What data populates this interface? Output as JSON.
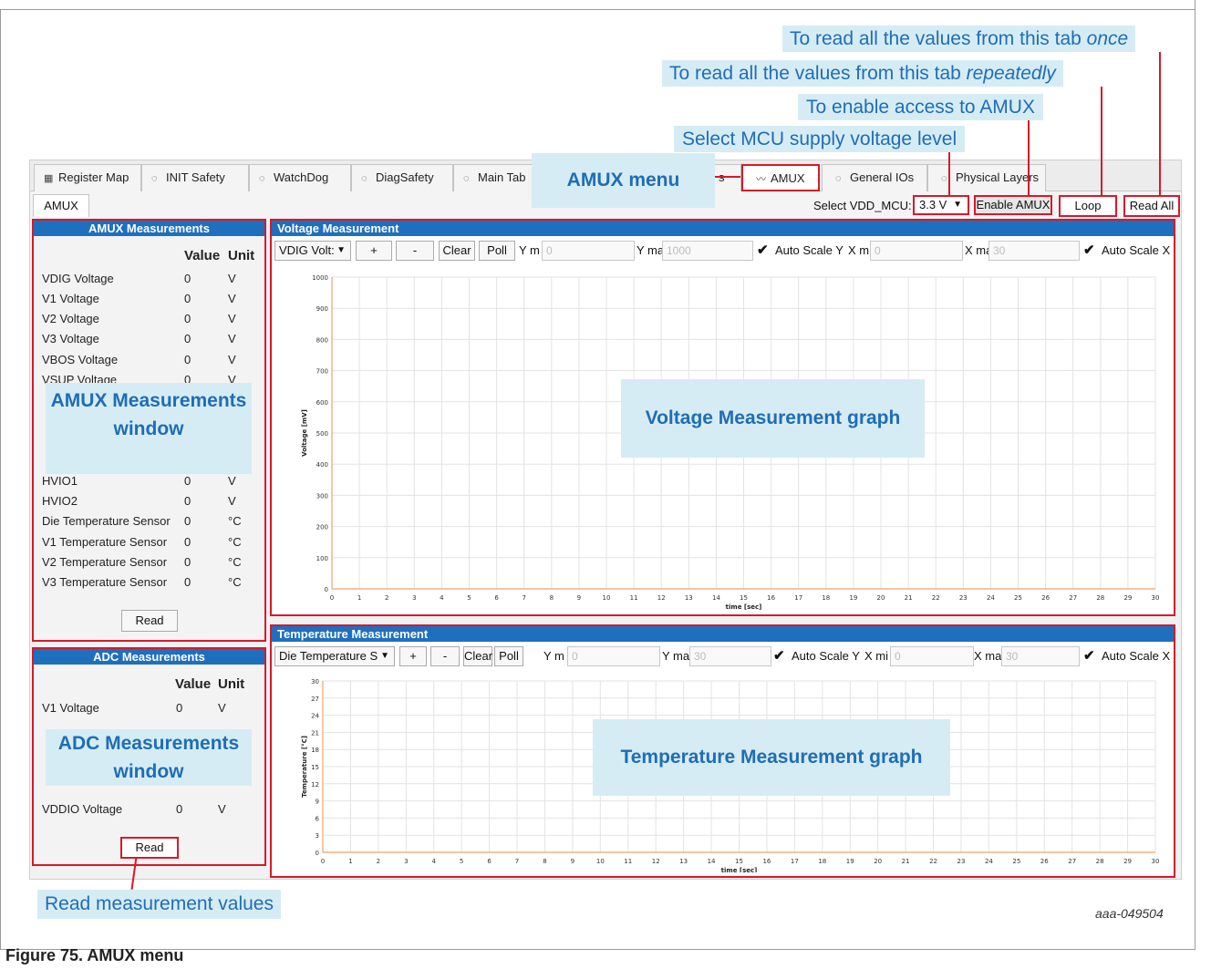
{
  "figure": {
    "caption": "Figure 75.  AMUX menu",
    "code": "aaa-049504"
  },
  "tabs": [
    {
      "label": "Register Map",
      "icon": "grid-icon"
    },
    {
      "label": "INIT Safety",
      "icon": "shield-icon"
    },
    {
      "label": "WatchDog",
      "icon": "shield-icon"
    },
    {
      "label": "DiagSafety",
      "icon": "shield-icon"
    },
    {
      "label": "Main Tab",
      "icon": "shield-icon"
    },
    {
      "label": "s",
      "icon": ""
    },
    {
      "label": "AMUX",
      "icon": "wave-icon"
    },
    {
      "label": "General IOs",
      "icon": "shield-icon"
    },
    {
      "label": "Physical Layers",
      "icon": "shield-icon"
    }
  ],
  "subtab": "AMUX",
  "controls": {
    "select_label": "Select VDD_MCU:",
    "select_value": "3.3 V",
    "enable_amux": "Enable AMUX",
    "loop": "Loop",
    "read_all": "Read All"
  },
  "amux_panel": {
    "title": "AMUX Measurements",
    "col_value": "Value",
    "col_unit": "Unit",
    "rows": [
      {
        "name": "VDIG Voltage",
        "value": "0",
        "unit": "V"
      },
      {
        "name": "V1 Voltage",
        "value": "0",
        "unit": "V"
      },
      {
        "name": "V2 Voltage",
        "value": "0",
        "unit": "V"
      },
      {
        "name": "V3 Voltage",
        "value": "0",
        "unit": "V"
      },
      {
        "name": "VBOS Voltage",
        "value": "0",
        "unit": "V"
      },
      {
        "name": "VSUP Voltage",
        "value": "0",
        "unit": "V"
      },
      {
        "name": "HVIO1",
        "value": "0",
        "unit": "V"
      },
      {
        "name": "HVIO2",
        "value": "0",
        "unit": "V"
      },
      {
        "name": "Die Temperature Sensor",
        "value": "0",
        "unit": "°C"
      },
      {
        "name": "V1 Temperature Sensor",
        "value": "0",
        "unit": "°C"
      },
      {
        "name": "V2 Temperature Sensor",
        "value": "0",
        "unit": "°C"
      },
      {
        "name": "V3 Temperature Sensor",
        "value": "0",
        "unit": "°C"
      }
    ],
    "read": "Read"
  },
  "adc_panel": {
    "title": "ADC Measurements",
    "col_value": "Value",
    "col_unit": "Unit",
    "rows": [
      {
        "name": "V1 Voltage",
        "value": "0",
        "unit": "V"
      },
      {
        "name": "VDDIO Voltage",
        "value": "0",
        "unit": "V"
      }
    ],
    "read": "Read"
  },
  "voltage_graph": {
    "title": "Voltage Measurement",
    "dropdown": "VDIG Volt:",
    "plus": "+",
    "minus": "-",
    "clear": "Clear",
    "poll": "Poll",
    "ymin_label": "Y m",
    "ymin_value": "0",
    "ymax_label": "Y ma",
    "ymax_value": "1000",
    "autoscale_y": "Auto Scale Y",
    "xmin_label": "X m",
    "xmin_value": "0",
    "xmax_label": "X ma",
    "xmax_value": "30",
    "autoscale_x": "Auto Scale X"
  },
  "temperature_graph": {
    "title": "Temperature Measurement",
    "dropdown": "Die Temperature S",
    "plus": "+",
    "minus": "-",
    "clear": "Clear",
    "poll": "Poll",
    "ymin_label": "Y m",
    "ymin_value": "0",
    "ymax_label": "Y ma",
    "ymax_value": "30",
    "autoscale_y": "Auto Scale Y",
    "xmin_label": "X mi",
    "xmin_value": "0",
    "xmax_label": "X ma",
    "xmax_value": "30",
    "autoscale_x": "Auto Scale X"
  },
  "chart_data": [
    {
      "type": "line",
      "xlabel": "time [sec]",
      "ylabel": "Voltage [mV]",
      "xlim": [
        0,
        30
      ],
      "ylim": [
        0,
        1000
      ],
      "xticks": [
        0,
        1,
        2,
        3,
        4,
        5,
        6,
        7,
        8,
        9,
        10,
        11,
        12,
        13,
        14,
        15,
        16,
        17,
        18,
        19,
        20,
        21,
        22,
        23,
        24,
        25,
        26,
        27,
        28,
        29,
        30
      ],
      "yticks": [
        0,
        100,
        200,
        300,
        400,
        500,
        600,
        700,
        800,
        900,
        1000
      ],
      "grid": true,
      "series": []
    },
    {
      "type": "line",
      "xlabel": "time [sec]",
      "ylabel": "Temperature [°C]",
      "xlim": [
        0,
        30
      ],
      "ylim": [
        0,
        30
      ],
      "xticks": [
        0,
        1,
        2,
        3,
        4,
        5,
        6,
        7,
        8,
        9,
        10,
        11,
        12,
        13,
        14,
        15,
        16,
        17,
        18,
        19,
        20,
        21,
        22,
        23,
        24,
        25,
        26,
        27,
        28,
        29,
        30
      ],
      "yticks": [
        0,
        3,
        6,
        9,
        12,
        15,
        18,
        21,
        24,
        27,
        30
      ],
      "grid": true,
      "series": []
    }
  ],
  "callouts": {
    "read_once": "To read all the values from this tab ",
    "read_once_em": "once",
    "read_repeat": "To read all the values from this tab ",
    "read_repeat_em": "repeatedly",
    "enable_amux": "To enable access to AMUX",
    "select_mcu": "Select MCU supply voltage level",
    "amux_menu": "AMUX menu",
    "amux_window": "AMUX Measurements window",
    "adc_window": "ADC Measurements window",
    "voltage_graph": "Voltage Measurement graph",
    "temperature_graph": "Temperature Measurement graph",
    "read_values": "Read measurement values"
  }
}
